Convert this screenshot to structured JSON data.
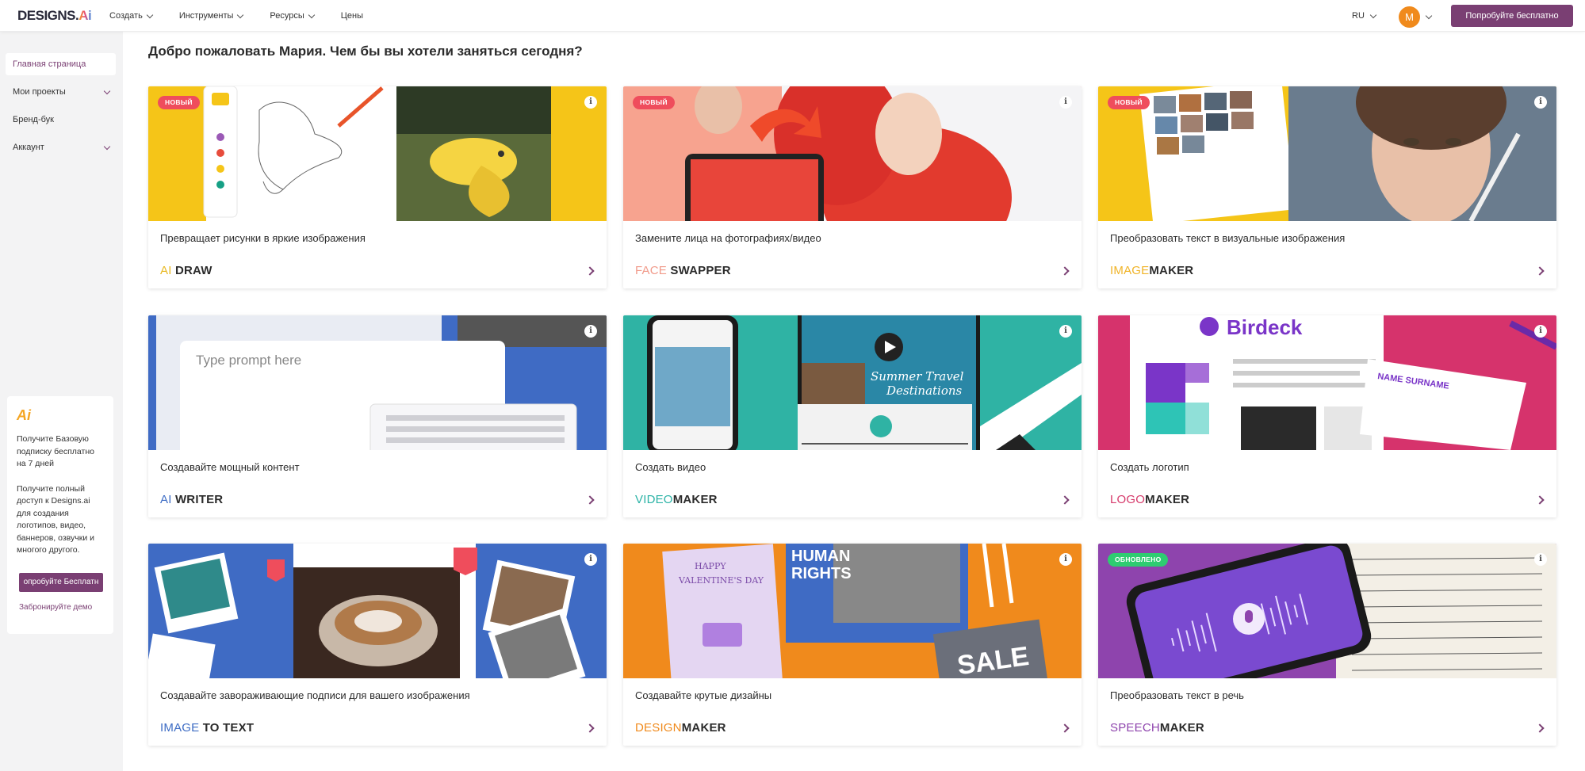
{
  "header": {
    "logo_main": "DESIGNS.",
    "logo_ai": "Ai",
    "nav": [
      {
        "label": "Создать"
      },
      {
        "label": "Инструменты"
      },
      {
        "label": "Ресурсы"
      },
      {
        "label": "Цены"
      }
    ],
    "language": "RU",
    "avatar_letter": "M",
    "try_button": "Попробуйте бесплатно"
  },
  "sidebar": {
    "items": [
      {
        "label": "Главная страница"
      },
      {
        "label": "Мои проекты"
      },
      {
        "label": "Бренд-бук"
      },
      {
        "label": "Аккаунт"
      }
    ],
    "promo": {
      "logo": "Ai",
      "text1": "Получите Базовую подписку бесплатно на 7 дней",
      "text2": "Получите полный доступ к Designs.ai для создания логотипов, видео, баннеров, озвучки и многого другого.",
      "button": "опробуйте Бесплатн",
      "link": "Забронируйте демо"
    }
  },
  "main": {
    "welcome": "Добро пожаловать Мария. Чем бы вы хотели заняться сегодня?",
    "cards": [
      {
        "badge": "НОВЫЙ",
        "desc": "Превращает рисунки в яркие изображения",
        "name_prefix": "AI ",
        "name_suffix": "DRAW",
        "prefix_color": "#e8b820"
      },
      {
        "badge": "НОВЫЙ",
        "desc": "Замените лица на фотографиях/видео",
        "name_prefix": "FACE ",
        "name_suffix": "SWAPPER",
        "prefix_color": "#f19a8a"
      },
      {
        "badge": "НОВЫЙ",
        "desc": "Преобразовать текст в визуальные изображения",
        "name_prefix": "IMAGE",
        "name_suffix": "MAKER",
        "prefix_color": "#f0b429"
      },
      {
        "badge": "",
        "desc": "Создавайте мощный контент",
        "name_prefix": "AI ",
        "name_suffix": "WRITER",
        "prefix_color": "#3d6cc4",
        "prompt_text": "Type prompt here"
      },
      {
        "badge": "",
        "desc": "Создать видео",
        "name_prefix": "VIDEO",
        "name_suffix": "MAKER",
        "prefix_color": "#2bb3a6",
        "video_text_1": "Summer Travel",
        "video_text_2": "Destinations"
      },
      {
        "badge": "",
        "desc": "Создать логотип",
        "name_prefix": "LOGO",
        "name_suffix": "MAKER",
        "prefix_color": "#d63a6b",
        "brand": "Birdeck",
        "card_name": "NAME SURNAME"
      },
      {
        "badge": "",
        "desc": "Создавайте завораживающие подписи для вашего изображения",
        "name_prefix": "IMAGE ",
        "name_suffix": "TO TEXT",
        "prefix_color": "#3d6cc4"
      },
      {
        "badge": "",
        "desc": "Создавайте крутые дизайны",
        "name_prefix": "DESIGN",
        "name_suffix": "MAKER",
        "prefix_color": "#f08a1c",
        "design_text_1": "HAPPY",
        "design_text_2": "VALENTINE'S DAY",
        "design_text_3": "HUMAN",
        "design_text_4": "RIGHTS",
        "design_text_5": "SALE"
      },
      {
        "badge": "ОБНОВЛЕНО",
        "desc": "Преобразовать текст в речь",
        "name_prefix": "SPEECH",
        "name_suffix": "MAKER",
        "prefix_color": "#8e44ad"
      }
    ]
  },
  "colors": {
    "brand": "#7a3f73",
    "badge_new": "#ef4d5c",
    "badge_updated": "#2ecc71"
  }
}
